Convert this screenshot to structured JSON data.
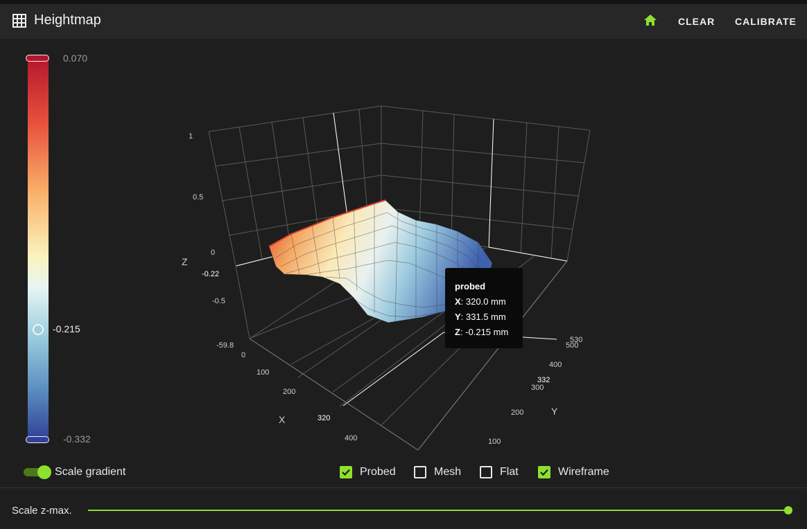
{
  "header": {
    "title": "Heightmap",
    "clear_label": "CLEAR",
    "calibrate_label": "CALIBRATE"
  },
  "scale": {
    "max_label": "0.070",
    "marker_label": "-0.215",
    "min_label": "-0.332"
  },
  "axes": {
    "z_title": "Z",
    "x_title": "X",
    "y_title": "Y",
    "z_ticks": [
      "1",
      "0.5",
      "0",
      "-0.22",
      "-0.5",
      "-59.8"
    ],
    "x_ticks": [
      "0",
      "100",
      "200",
      "320",
      "400"
    ],
    "y_ticks": [
      "100",
      "200",
      "300",
      "332",
      "400",
      "500",
      "530"
    ]
  },
  "tooltip": {
    "title": "probed",
    "x_key": "X",
    "x_value": ": 320.0 mm",
    "y_key": "Y",
    "y_value": ": 331.5 mm",
    "z_key": "Z",
    "z_value": ": -0.215 mm"
  },
  "controls": {
    "scale_gradient_label": "Scale gradient",
    "scale_gradient_on": true,
    "probed_label": "Probed",
    "probed_checked": true,
    "mesh_label": "Mesh",
    "mesh_checked": false,
    "flat_label": "Flat",
    "flat_checked": false,
    "wireframe_label": "Wireframe",
    "wireframe_checked": true,
    "zmax_label": "Scale z-max.",
    "zmax_value": 1.0
  },
  "colors": {
    "accent": "#8ee02e",
    "background": "#1e1e1e",
    "header": "#272727"
  }
}
